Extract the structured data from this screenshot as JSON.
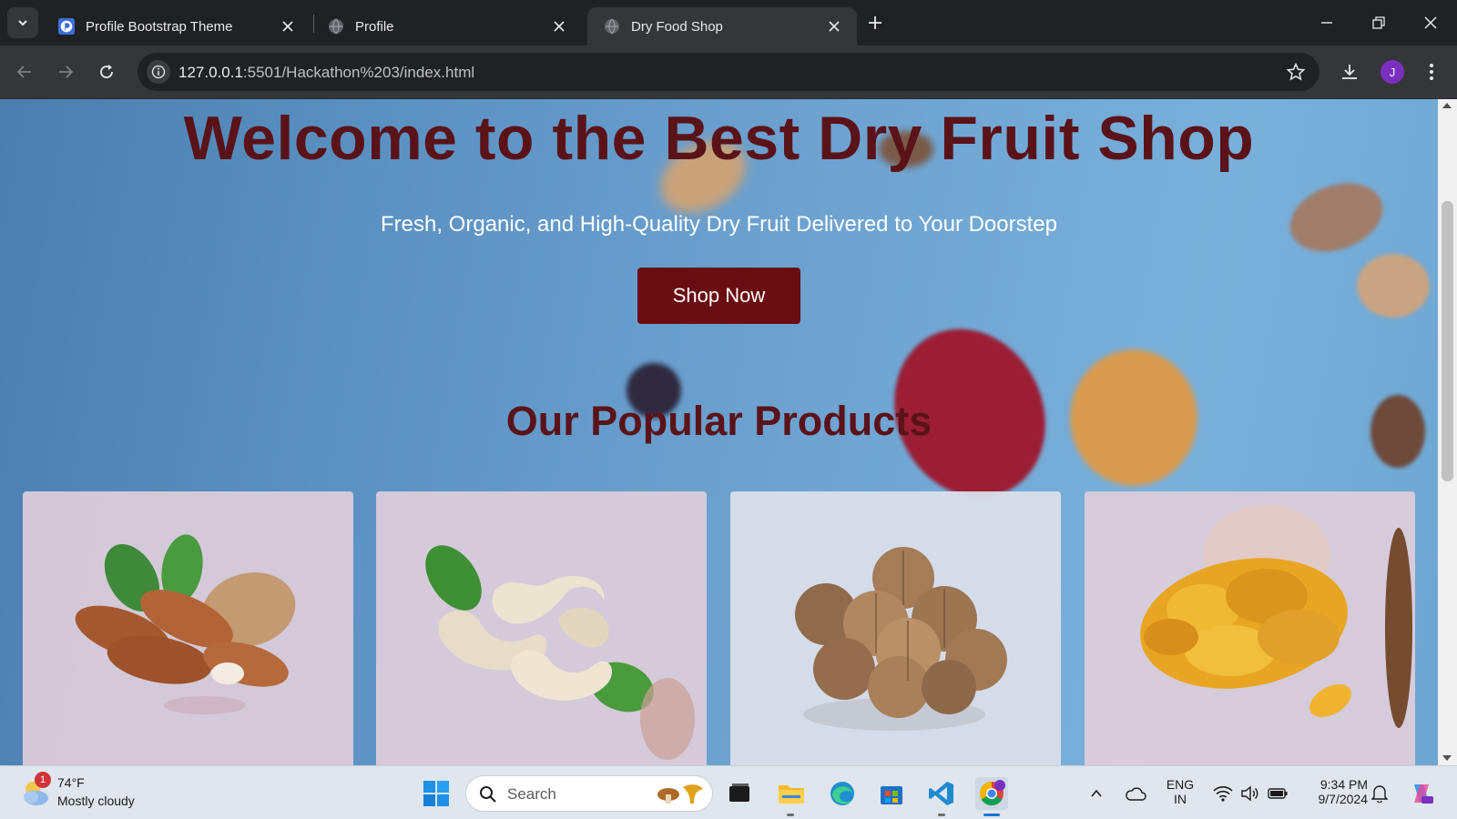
{
  "browser": {
    "tabs": [
      {
        "title": "Profile Bootstrap Theme",
        "active": false,
        "favicon": "bootstrap-p-icon"
      },
      {
        "title": "Profile",
        "active": false,
        "favicon": "globe-icon"
      },
      {
        "title": "Dry Food Shop",
        "active": true,
        "favicon": "globe-icon"
      }
    ],
    "url_host": "127.0.0.1",
    "url_rest": ":5501/Hackathon%203/index.html",
    "profile_initial": "J"
  },
  "page": {
    "hero_title": "Welcome to the Best Dry Fruit Shop",
    "hero_subtitle": "Fresh, Organic, and High-Quality Dry Fruit Delivered to Your Doorstep",
    "cta_label": "Shop Now",
    "section_title": "Our Popular Products",
    "products": [
      {
        "image": "almonds-image"
      },
      {
        "image": "cashews-image"
      },
      {
        "image": "walnuts-image"
      },
      {
        "image": "raisins-image"
      }
    ],
    "colors": {
      "title": "#5a1319",
      "button": "#6a0d12",
      "background": "#6ea3d1"
    }
  },
  "taskbar": {
    "weather_temp": "74°F",
    "weather_desc": "Mostly cloudy",
    "weather_badge": "1",
    "search_placeholder": "Search",
    "lang_line1": "ENG",
    "lang_line2": "IN",
    "time": "9:34 PM",
    "date": "9/7/2024"
  }
}
